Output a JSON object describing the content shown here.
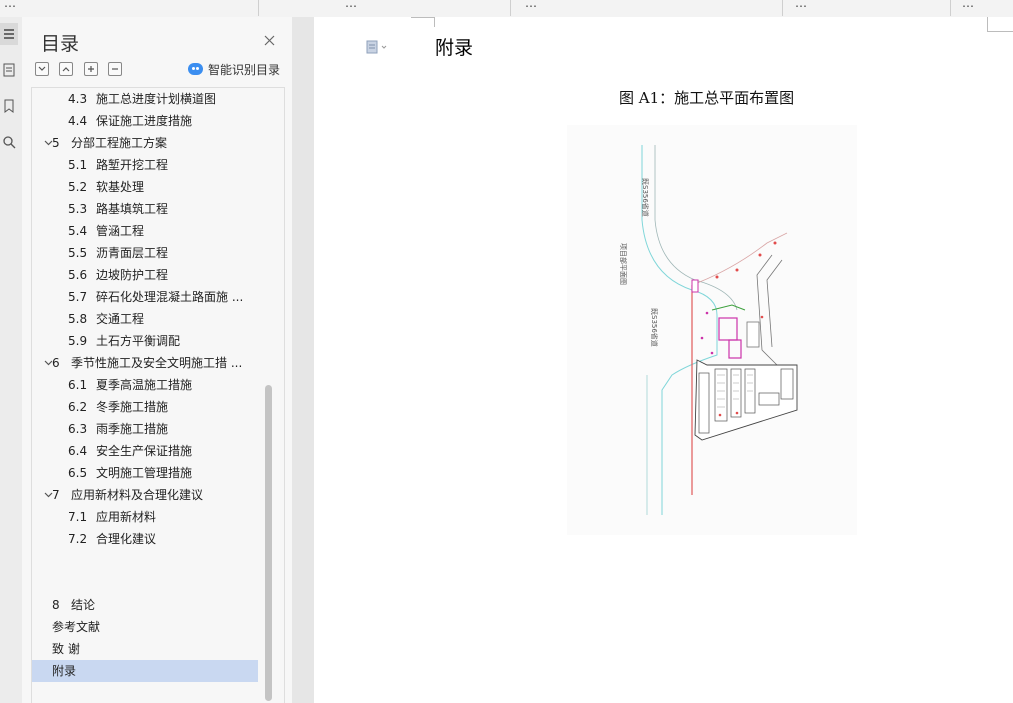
{
  "toolbar": {
    "items": [
      "…",
      "…",
      "…",
      "…",
      "…"
    ]
  },
  "toc_panel": {
    "title": "目录",
    "smart_toc_label": "智能识别目录",
    "items": [
      {
        "num": "4.3",
        "label": "施工总进度计划横道图",
        "level": 2
      },
      {
        "num": "4.4",
        "label": "保证施工进度措施",
        "level": 2
      },
      {
        "num": "5",
        "label": "分部工程施工方案",
        "level": 1,
        "expanded": true
      },
      {
        "num": "5.1",
        "label": "路堑开挖工程",
        "level": 2
      },
      {
        "num": "5.2",
        "label": "软基处理",
        "level": 2
      },
      {
        "num": "5.3",
        "label": "路基填筑工程",
        "level": 2
      },
      {
        "num": "5.4",
        "label": "管涵工程",
        "level": 2
      },
      {
        "num": "5.5",
        "label": "沥青面层工程",
        "level": 2
      },
      {
        "num": "5.6",
        "label": "边坡防护工程",
        "level": 2
      },
      {
        "num": "5.7",
        "label": "碎石化处理混凝土路面施 ...",
        "level": 2
      },
      {
        "num": "5.8",
        "label": "交通工程",
        "level": 2
      },
      {
        "num": "5.9",
        "label": "土石方平衡调配",
        "level": 2
      },
      {
        "num": "6",
        "label": "季节性施工及安全文明施工措 ...",
        "level": 1,
        "expanded": true
      },
      {
        "num": "6.1",
        "label": "夏季高温施工措施",
        "level": 2
      },
      {
        "num": "6.2",
        "label": "冬季施工措施",
        "level": 2
      },
      {
        "num": "6.3",
        "label": "雨季施工措施",
        "level": 2
      },
      {
        "num": "6.4",
        "label": "安全生产保证措施",
        "level": 2
      },
      {
        "num": "6.5",
        "label": "文明施工管理措施",
        "level": 2
      },
      {
        "num": "7",
        "label": "应用新材料及合理化建议",
        "level": 1,
        "expanded": true
      },
      {
        "num": "7.1",
        "label": "应用新材料",
        "level": 2
      },
      {
        "num": "7.2",
        "label": "合理化建议",
        "level": 2
      },
      {
        "num": "8",
        "label": "结论",
        "level": 1
      },
      {
        "num": "",
        "label": "参考文献",
        "level": 1
      },
      {
        "num": "",
        "label": "致 谢",
        "level": 1
      },
      {
        "num": "",
        "label": "附录",
        "level": 1,
        "selected": true
      }
    ]
  },
  "document": {
    "heading": "附录",
    "figure_caption": "图 A1：施工总平面布置图",
    "figure_labels": {
      "road_1": "既S356省道",
      "road_2": "既S356省道",
      "plan_note": "项目部平面图"
    }
  },
  "colors": {
    "selection": "#c9d8f1",
    "accent": "#3b8ef0"
  }
}
